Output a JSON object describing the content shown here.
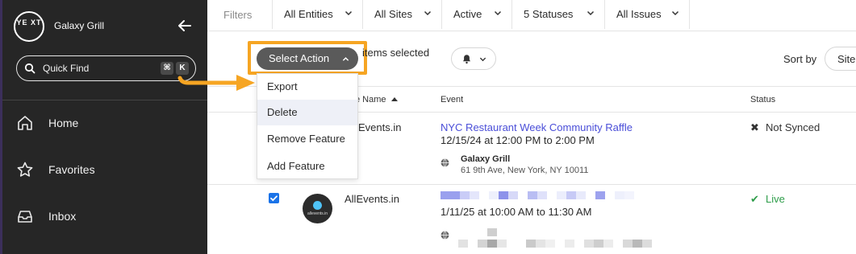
{
  "sidebar": {
    "logo_text": "YE XT",
    "brand": "Galaxy Grill",
    "collapse_icon": "arrow-left-icon",
    "quick_find": {
      "placeholder": "Quick Find",
      "shortcut_cmd": "⌘",
      "shortcut_key": "K"
    },
    "items": [
      {
        "label": "Home",
        "icon": "home-icon"
      },
      {
        "label": "Favorites",
        "icon": "star-icon"
      },
      {
        "label": "Inbox",
        "icon": "inbox-icon"
      }
    ]
  },
  "filters": {
    "label": "Filters",
    "buttons": [
      "All Entities",
      "All Sites",
      "Active",
      "5 Statuses",
      "All Issues"
    ]
  },
  "toolbar": {
    "select_action": "Select Action",
    "items_selected": "items selected",
    "sort_by": "Sort by",
    "sort_value": "Site"
  },
  "dropdown": {
    "items": [
      "Export",
      "Delete",
      "Remove Feature",
      "Add Feature"
    ],
    "hovered_index": 1
  },
  "table": {
    "headers": {
      "site_name": "e Name",
      "event": "Event",
      "status": "Status"
    },
    "rows": [
      {
        "site": "Events.in",
        "event_title": "NYC Restaurant Week Community Raffle",
        "event_time": "12/15/24 at 12:00 PM to 2:00 PM",
        "location_name": "Galaxy Grill",
        "location_address": "61 9th Ave, New York, NY 10011",
        "status": "Not Synced",
        "status_color": "#333333"
      },
      {
        "site": "AllEvents.in",
        "event_time": "1/11/25 at 10:00 AM to 11:30 AM",
        "status": "Live",
        "status_color": "#2e9d4a",
        "checked": true,
        "avatar_caption": "allevents.in"
      }
    ]
  },
  "colors": {
    "sidebar_bg": "#262626",
    "highlight": "#f6a523",
    "link": "#4a4ed8",
    "live": "#2e9d4a",
    "checkbox": "#1a73e8"
  }
}
